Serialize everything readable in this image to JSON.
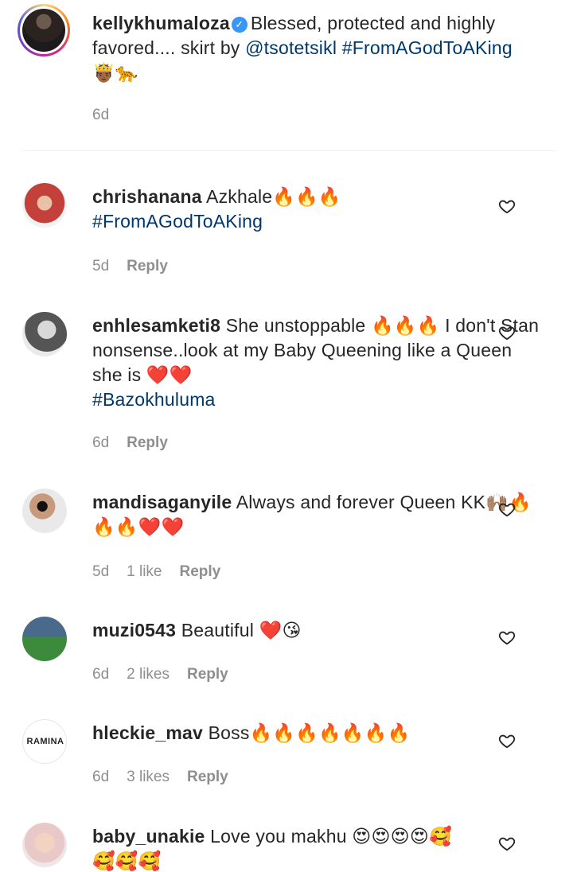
{
  "caption": {
    "username": "kellykhumaloza",
    "text": "Blessed, protected and highly favored.... skirt by ",
    "mention": "@tsotetsikl",
    "hashtag": "#FromAGodToAKing",
    "emoji": "🤴🏾🐆",
    "time": "6d"
  },
  "comments": [
    {
      "username": "chrishanana",
      "text": "Azkhale🔥🔥🔥",
      "hashtag": "#FromAGodToAKing",
      "time": "5d",
      "likes": "",
      "reply": "Reply"
    },
    {
      "username": "enhlesamketi8",
      "text": "She unstoppable 🔥🔥🔥 I don't Stan nonsense..look at my Baby Queening like a Queen she is ❤️❤️",
      "hashtag": "#Bazokhuluma",
      "time": "6d",
      "likes": "",
      "reply": "Reply"
    },
    {
      "username": "mandisaganyile",
      "text": "Always and forever Queen KK🙌🏽🔥🔥🔥❤️❤️",
      "hashtag": "",
      "time": "5d",
      "likes": "1 like",
      "reply": "Reply"
    },
    {
      "username": "muzi0543",
      "text": "Beautiful ❤️😘",
      "hashtag": "",
      "time": "6d",
      "likes": "2 likes",
      "reply": "Reply"
    },
    {
      "username": "hleckie_mav",
      "text": "Boss🔥🔥🔥🔥🔥🔥🔥",
      "hashtag": "",
      "time": "6d",
      "likes": "3 likes",
      "reply": "Reply"
    },
    {
      "username": "baby_unakie",
      "text": "Love you makhu 😍😍😍😍🥰🥰🥰🥰",
      "hashtag": "",
      "time": "",
      "likes": "",
      "reply": ""
    }
  ],
  "avatar_logo_text": "RAMINA",
  "icons": {
    "heart": "heart-outline-icon",
    "verified": "verified-badge-icon"
  }
}
